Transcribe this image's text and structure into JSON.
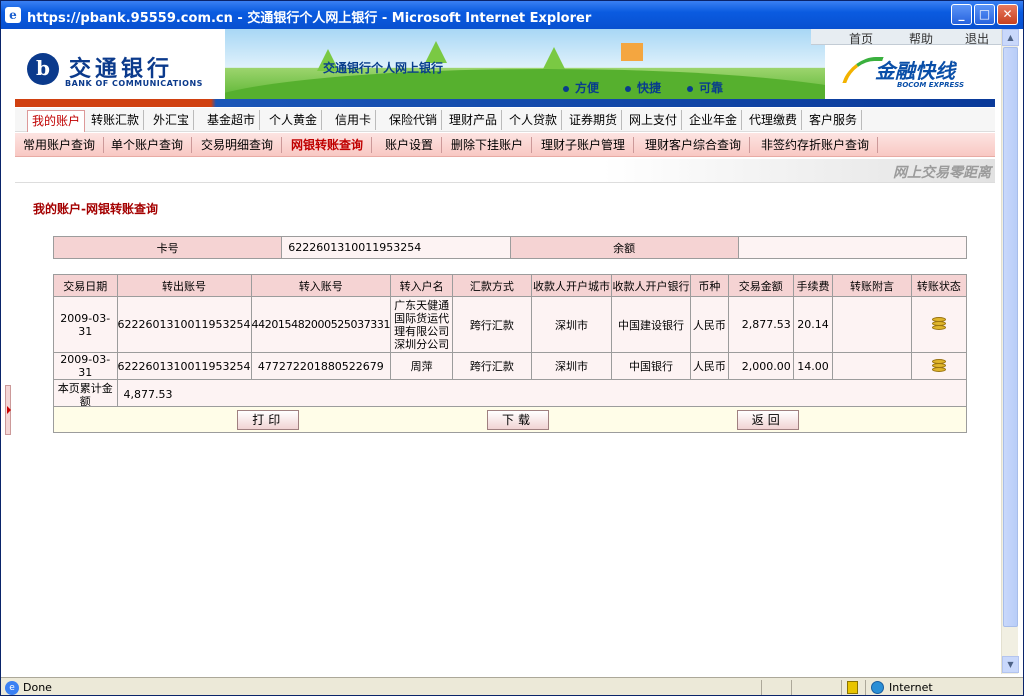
{
  "window": {
    "title": "https://pbank.95559.com.cn - 交通银行个人网上银行 - Microsoft Internet Explorer",
    "minimize_icon": "minimize-icon",
    "maximize_icon": "maximize-icon",
    "close_icon": "close-icon"
  },
  "header": {
    "logo_cn": "交通银行",
    "logo_en": "BANK OF COMMUNICATIONS",
    "banner_text": "交通银行个人网上银行",
    "slogans": [
      "方便",
      "快捷",
      "可靠"
    ],
    "top_links": [
      "首页",
      "帮助",
      "退出"
    ],
    "express_cn": "金融快线",
    "express_en": "BOCOM EXPRESS"
  },
  "nav_main": [
    "我的账户",
    "转账汇款",
    "外汇宝",
    "基金超市",
    "个人黄金",
    "信用卡",
    "保险代销",
    "理财产品",
    "个人贷款",
    "证券期货",
    "网上支付",
    "企业年金",
    "代理缴费",
    "客户服务"
  ],
  "nav_sub": [
    "常用账户查询",
    "单个账户查询",
    "交易明细查询",
    "网银转账查询",
    "账户设置",
    "删除下挂账户",
    "理财子账户管理",
    "理财客户综合查询",
    "非签约存折账户查询"
  ],
  "motto": "网上交易零距离",
  "page_title": "我的账户-网银转账查询",
  "summary": {
    "card_label": "卡号",
    "card_value": "6222601310011953254",
    "balance_label": "余额",
    "balance_value": ""
  },
  "table": {
    "headers": [
      "交易日期",
      "转出账号",
      "转入账号",
      "转入户名",
      "汇款方式",
      "收款人开户城市",
      "收款人开户银行",
      "币种",
      "交易金额",
      "手续费",
      "转账附言",
      "转账状态"
    ],
    "rows": [
      [
        "2009-03-31",
        "6222601310011953254",
        "442015482000525037331",
        "广东天健通国际货运代理有限公司深圳分公司",
        "跨行汇款",
        "深圳市",
        "中国建设银行",
        "人民币",
        "2,877.53",
        "20.14",
        "",
        "coins-icon"
      ],
      [
        "2009-03-31",
        "6222601310011953254",
        "477272201880522679",
        "周萍",
        "跨行汇款",
        "深圳市",
        "中国银行",
        "人民币",
        "2,000.00",
        "14.00",
        "",
        "coins-icon"
      ]
    ],
    "total_label": "本页累计金额",
    "total_value": "4,877.53"
  },
  "buttons": {
    "print": "打印",
    "download": "下载",
    "back": "返回"
  },
  "statusbar": {
    "text": "Done",
    "zone": "Internet"
  }
}
